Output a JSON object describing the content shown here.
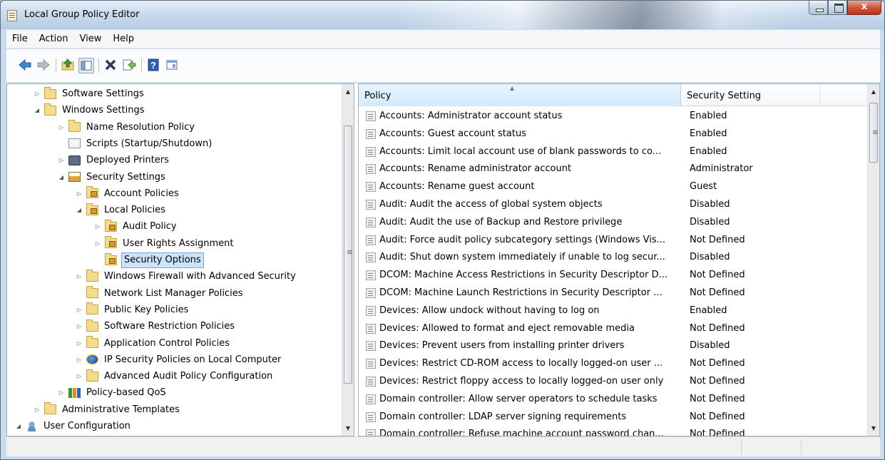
{
  "window": {
    "title": "Local Group Policy Editor",
    "close_glyph": "x"
  },
  "menu": [
    "File",
    "Action",
    "View",
    "Help"
  ],
  "toolbar": {
    "icons": [
      "back-icon",
      "forward-icon",
      "up-folder-icon",
      "show-hide-tree-icon",
      "delete-icon",
      "export-list-icon",
      "help-icon",
      "properties-icon"
    ]
  },
  "tree": {
    "items": [
      {
        "label": "Software Settings",
        "level": 2,
        "twisty": "collapsed",
        "icon": "folder"
      },
      {
        "label": "Windows Settings",
        "level": 2,
        "twisty": "expanded",
        "icon": "folder"
      },
      {
        "label": "Name Resolution Policy",
        "level": 3,
        "twisty": "collapsed",
        "icon": "folder"
      },
      {
        "label": "Scripts (Startup/Shutdown)",
        "level": 3,
        "twisty": "none",
        "icon": "script"
      },
      {
        "label": "Deployed Printers",
        "level": 3,
        "twisty": "collapsed",
        "icon": "printer"
      },
      {
        "label": "Security Settings",
        "level": 3,
        "twisty": "expanded",
        "icon": "security"
      },
      {
        "label": "Account Policies",
        "level": 4,
        "twisty": "collapsed",
        "icon": "folder-lock"
      },
      {
        "label": "Local Policies",
        "level": 4,
        "twisty": "expanded",
        "icon": "folder-lock"
      },
      {
        "label": "Audit Policy",
        "level": 5,
        "twisty": "collapsed",
        "icon": "folder-lock"
      },
      {
        "label": "User Rights Assignment",
        "level": 5,
        "twisty": "collapsed",
        "icon": "folder-lock"
      },
      {
        "label": "Security Options",
        "level": 5,
        "twisty": "none",
        "icon": "folder-lock",
        "selected": true
      },
      {
        "label": "Windows Firewall with Advanced Security",
        "level": 4,
        "twisty": "collapsed",
        "icon": "folder"
      },
      {
        "label": "Network List Manager Policies",
        "level": 4,
        "twisty": "none",
        "icon": "folder"
      },
      {
        "label": "Public Key Policies",
        "level": 4,
        "twisty": "collapsed",
        "icon": "folder"
      },
      {
        "label": "Software Restriction Policies",
        "level": 4,
        "twisty": "collapsed",
        "icon": "folder"
      },
      {
        "label": "Application Control Policies",
        "level": 4,
        "twisty": "collapsed",
        "icon": "folder"
      },
      {
        "label": "IP Security Policies on Local Computer",
        "level": 4,
        "twisty": "collapsed",
        "icon": "ipsec"
      },
      {
        "label": "Advanced Audit Policy Configuration",
        "level": 4,
        "twisty": "collapsed",
        "icon": "folder"
      },
      {
        "label": "Policy-based QoS",
        "level": 3,
        "twisty": "collapsed",
        "icon": "qos"
      },
      {
        "label": "Administrative Templates",
        "level": 2,
        "twisty": "collapsed",
        "icon": "folder"
      },
      {
        "label": "User Configuration",
        "level": 1,
        "twisty": "expanded",
        "icon": "user"
      }
    ]
  },
  "list": {
    "columns": [
      "Policy",
      "Security Setting"
    ],
    "rows": [
      {
        "policy": "Accounts: Administrator account status",
        "setting": "Enabled"
      },
      {
        "policy": "Accounts: Guest account status",
        "setting": "Enabled"
      },
      {
        "policy": "Accounts: Limit local account use of blank passwords to co...",
        "setting": "Enabled"
      },
      {
        "policy": "Accounts: Rename administrator account",
        "setting": "Administrator"
      },
      {
        "policy": "Accounts: Rename guest account",
        "setting": "Guest"
      },
      {
        "policy": "Audit: Audit the access of global system objects",
        "setting": "Disabled"
      },
      {
        "policy": "Audit: Audit the use of Backup and Restore privilege",
        "setting": "Disabled"
      },
      {
        "policy": "Audit: Force audit policy subcategory settings (Windows Vis...",
        "setting": "Not Defined"
      },
      {
        "policy": "Audit: Shut down system immediately if unable to log secur...",
        "setting": "Disabled"
      },
      {
        "policy": "DCOM: Machine Access Restrictions in Security Descriptor D...",
        "setting": "Not Defined"
      },
      {
        "policy": "DCOM: Machine Launch Restrictions in Security Descriptor ...",
        "setting": "Not Defined"
      },
      {
        "policy": "Devices: Allow undock without having to log on",
        "setting": "Enabled"
      },
      {
        "policy": "Devices: Allowed to format and eject removable media",
        "setting": "Not Defined"
      },
      {
        "policy": "Devices: Prevent users from installing printer drivers",
        "setting": "Disabled"
      },
      {
        "policy": "Devices: Restrict CD-ROM access to locally logged-on user ...",
        "setting": "Not Defined"
      },
      {
        "policy": "Devices: Restrict floppy access to locally logged-on user only",
        "setting": "Not Defined"
      },
      {
        "policy": "Domain controller: Allow server operators to schedule tasks",
        "setting": "Not Defined"
      },
      {
        "policy": "Domain controller: LDAP server signing requirements",
        "setting": "Not Defined"
      },
      {
        "policy": "Domain controller: Refuse machine account password chan...",
        "setting": "Not Defined"
      }
    ]
  }
}
